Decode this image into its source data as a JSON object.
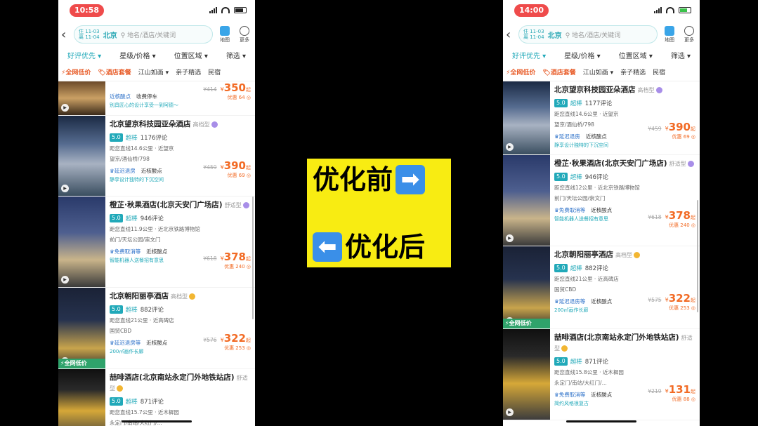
{
  "banner": {
    "before_text": "优化前",
    "before_arrow": "➡",
    "after_arrow": "⬅",
    "after_text": "优化后"
  },
  "phones": [
    {
      "status_time": "10:58",
      "search": {
        "checkin": "住 11-03",
        "checkout": "离 11-04",
        "city": "北京",
        "placeholder": "地名/酒店/关键词"
      },
      "header_icons": [
        "地图",
        "更多"
      ],
      "filters": [
        "好评优先 ▾",
        "星级/价格 ▾",
        "位置区域 ▾",
        "筛选 ▾"
      ],
      "tags": [
        "⚡全网低价",
        "🏷酒店套餐",
        "江山如画 ▾",
        "亲子精选",
        "民宿"
      ],
      "hotels": [
        {
          "name": "",
          "type": "",
          "score": "",
          "score_label": "",
          "reviews": "",
          "distance": "",
          "area": "",
          "perk1": "近核酸点",
          "perk2": "收费停车",
          "orig": "¥414",
          "price": "350",
          "discount": "优惠 64 ◎",
          "promo": "别具匠心的设计享受一到阿德～",
          "ribbon": "",
          "h": 49
        },
        {
          "name": "北京望京科技园亚朵酒店",
          "type": "高档型",
          "score": "5.0",
          "score_label": "超棒",
          "reviews": "1176评论",
          "distance": "距您直线14.6公里 · 近望京",
          "area": "望京/酒仙桥/798",
          "perk1": "♛延迟退房",
          "perk2": "近核酸点",
          "orig": "¥459",
          "price": "390",
          "discount": "优惠 69 ◎",
          "promo": "静享设计独特的下沉空间",
          "ribbon": "",
          "h": 115
        },
        {
          "name": "橙芷·秋果酒店(北京天安门广场店)",
          "type": "舒适型",
          "score": "5.0",
          "score_label": "超棒",
          "reviews": "946评论",
          "distance": "距您直线11.9公里 · 近北京铁路博物馆",
          "area": "前门/天坛公园/崇文门",
          "perk1": "♛免费取消等",
          "perk2": "近核酸点",
          "orig": "¥618",
          "price": "378",
          "discount": "优惠 240 ◎",
          "promo": "智能机器人送餐招有意思",
          "ribbon": "",
          "h": 130
        },
        {
          "name": "北京朝阳丽亭酒店",
          "type": "高档型",
          "score": "5.0",
          "score_label": "超棒",
          "reviews": "882评论",
          "distance": "距您直线21公里 · 近高碑店",
          "area": "国贸CBD",
          "perk1": "♛延迟退房等",
          "perk2": "近核酸点",
          "orig": "¥576",
          "price": "322",
          "discount": "优惠 253 ◎",
          "promo": "200㎡画作长廊",
          "ribbon": "⚡全网低价",
          "h": 116
        },
        {
          "name": "喆啡酒店(北京南站永定门外地铁站店)",
          "type": "舒适型",
          "score": "5.0",
          "score_label": "超棒",
          "reviews": "871评论",
          "distance": "距您直线15.7公里 · 近木樨园",
          "area": "永定门/南站/大红门/...",
          "perk1": "",
          "perk2": "",
          "orig": "",
          "price": "",
          "discount": "",
          "promo": "",
          "ribbon": "",
          "h": 100
        }
      ]
    },
    {
      "status_time": "14:00",
      "search": {
        "checkin": "住 11-03",
        "checkout": "离 11-04",
        "city": "北京",
        "placeholder": "地名/酒店/关键词"
      },
      "header_icons": [
        "地图",
        "更多"
      ],
      "filters": [
        "好评优先 ▾",
        "星级/价格 ▾",
        "位置区域 ▾",
        "筛选 ▾"
      ],
      "tags": [
        "⚡全网低价",
        "🏷酒店套餐",
        "江山如画 ▾",
        "亲子精选",
        "民宿"
      ],
      "hotels": [
        {
          "name": "北京望京科技园亚朵酒店",
          "type": "高档型",
          "score": "5.0",
          "score_label": "超棒",
          "reviews": "1177评论",
          "distance": "距您直线14.6公里 · 近望京",
          "area": "望京/酒仙桥/798",
          "perk1": "♛延迟退房",
          "perk2": "近核酸点",
          "orig": "¥459",
          "price": "390",
          "discount": "优惠 69 ◎",
          "promo": "静享设计独特的下沉空间",
          "ribbon": "",
          "h": 105
        },
        {
          "name": "橙芷·秋果酒店(北京天安门广场店)",
          "type": "舒适型",
          "score": "5.0",
          "score_label": "超棒",
          "reviews": "946评论",
          "distance": "距您直线12公里 · 近北京铁路博物馆",
          "area": "前门/天坛公园/崇文门",
          "perk1": "♛免费取消等",
          "perk2": "近核酸点",
          "orig": "¥618",
          "price": "378",
          "discount": "优惠 240 ◎",
          "promo": "智能机器人送餐招有意思",
          "ribbon": "",
          "h": 130
        },
        {
          "name": "北京朝阳丽亭酒店",
          "type": "高档型",
          "score": "5.0",
          "score_label": "超棒",
          "reviews": "882评论",
          "distance": "距您直线21公里 · 近高碑店",
          "area": "国贸CBD",
          "perk1": "♛延迟退房等",
          "perk2": "近核酸点",
          "orig": "¥575",
          "price": "322",
          "discount": "优惠 253 ◎",
          "promo": "200㎡画作长廊",
          "ribbon": "⚡全网低价",
          "h": 118
        },
        {
          "name": "喆啡酒店(北京南站永定门外地铁站店)",
          "type": "舒适型",
          "score": "5.0",
          "score_label": "超棒",
          "reviews": "871评论",
          "distance": "距您直线15.8公里 · 近木樨园",
          "area": "永定门/南站/大红门/...",
          "perk1": "♛免费取消等",
          "perk2": "近核酸点",
          "orig": "¥219",
          "price": "131",
          "discount": "优惠 88 ◎",
          "promo": "简约风格很复古",
          "ribbon": "",
          "h": 130
        }
      ]
    }
  ]
}
